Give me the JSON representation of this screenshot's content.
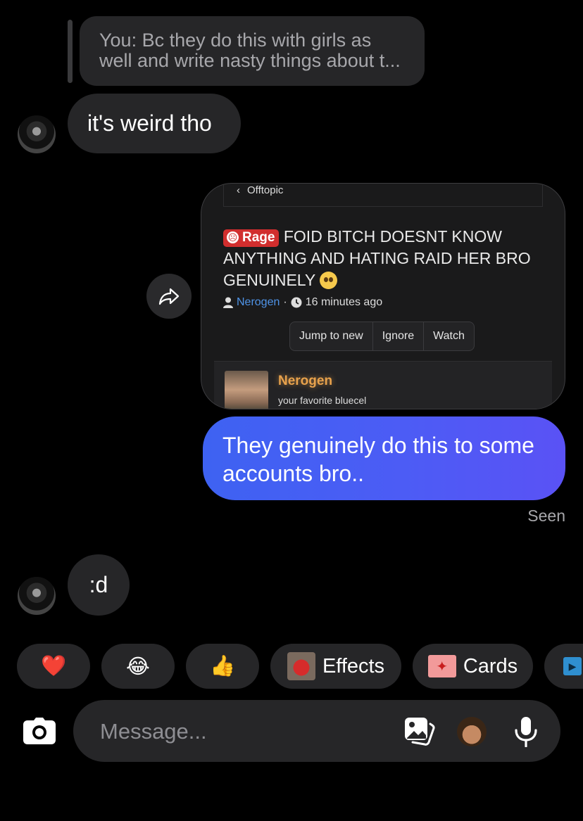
{
  "reply": {
    "line1": "You: Bc they do this with girls as",
    "line2": "well and write nasty things about t..."
  },
  "messages": {
    "incoming1": "it's weird tho",
    "outgoing1_line1": "They genuinely do this to some",
    "outgoing1_line2": "accounts bro..",
    "seen": "Seen",
    "incoming2": ":d"
  },
  "shared_post": {
    "breadcrumb": "Offtopic",
    "badge": "Rage",
    "title_line1": "FOID BITCH DOESNT KNOW",
    "title_line2": "ANYTHING AND HATING RAID HER BRO",
    "title_line3": "GENUINELY",
    "author": "Nerogen",
    "time": "16 minutes ago",
    "actions": [
      "Jump to new",
      "Ignore",
      "Watch"
    ],
    "poster_name": "Nerogen",
    "poster_subtitle": "your favorite bluecel"
  },
  "quick_actions": {
    "heart": "❤️",
    "laugh": "😂",
    "thumbs": "👍",
    "effects": "Effects",
    "cards": "Cards"
  },
  "composer": {
    "placeholder": "Message..."
  },
  "colors": {
    "outgoing_bubble": "#4c5cf5",
    "incoming_bubble": "#262628",
    "username_link": "#4f94e8",
    "poster_name": "#e8a24c",
    "rage_badge": "#d12e2e"
  },
  "icons": [
    "forward-icon",
    "camera-icon",
    "gallery-icon",
    "memoji-icon",
    "microphone-icon",
    "chevron-left-icon",
    "user-icon",
    "clock-icon"
  ]
}
